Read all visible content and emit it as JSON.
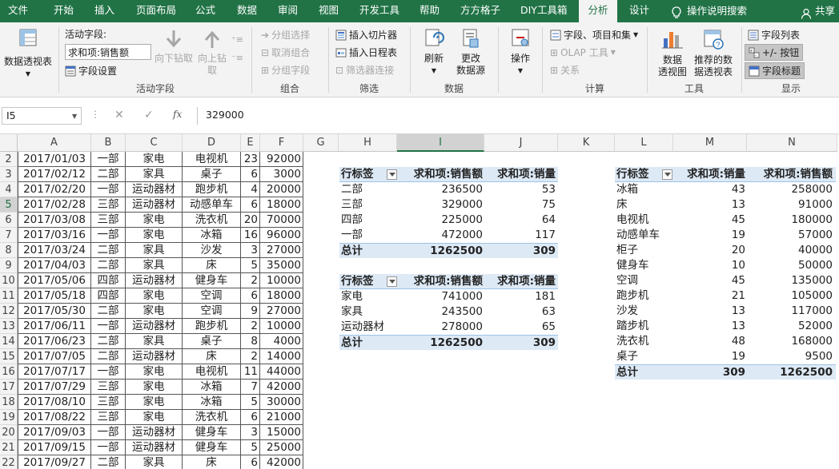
{
  "tabs": [
    "文件",
    "开始",
    "插入",
    "页面布局",
    "公式",
    "数据",
    "审阅",
    "视图",
    "开发工具",
    "帮助",
    "方方格子",
    "DIY工具箱",
    "分析",
    "设计"
  ],
  "tell_me": "操作说明搜索",
  "share": "共享",
  "ribbon": {
    "pivot_table": "数据透视表",
    "active_field_label": "活动字段:",
    "active_field_value": "求和项:销售额",
    "field_settings": "字段设置",
    "drill_down": "向下钻取",
    "drill_up_1": "向上钻",
    "drill_up_2": "取",
    "group_active_field": "活动字段",
    "group_selection": "分组选择",
    "ungroup": "取消组合",
    "group_field": "分组字段",
    "group_group": "组合",
    "insert_slicer": "插入切片器",
    "insert_timeline": "插入日程表",
    "filter_connections": "筛选器连接",
    "group_filter": "筛选",
    "refresh": "刷新",
    "change_source_1": "更改",
    "change_source_2": "数据源",
    "group_data": "数据",
    "actions": "操作",
    "fields_items_sets": "字段、项目和集",
    "olap_tools": "OLAP 工具",
    "relationships": "关系",
    "group_calc": "计算",
    "pivot_chart_1": "数据",
    "pivot_chart_2": "透视图",
    "recommended_1": "推荐的数",
    "recommended_2": "据透视表",
    "group_tools": "工具",
    "field_list": "字段列表",
    "plus_minus": "+/- 按钮",
    "field_headers": "字段标题",
    "group_show": "显示"
  },
  "formula_bar": {
    "name_box": "I5",
    "cancel": "✕",
    "enter": "✓",
    "fx": "fx",
    "content": "329000"
  },
  "columns": [
    "A",
    "B",
    "C",
    "D",
    "E",
    "F",
    "G",
    "H",
    "I",
    "J",
    "K",
    "L",
    "M",
    "N"
  ],
  "rows": [
    {
      "num": "2",
      "a": "2017/01/03",
      "b": "一部",
      "c": "家电",
      "d": "电视机",
      "e": "23",
      "f": "92000"
    },
    {
      "num": "3",
      "a": "2017/02/12",
      "b": "二部",
      "c": "家具",
      "d": "桌子",
      "e": "6",
      "f": "3000"
    },
    {
      "num": "4",
      "a": "2017/02/20",
      "b": "一部",
      "c": "运动器材",
      "d": "跑步机",
      "e": "4",
      "f": "20000"
    },
    {
      "num": "5",
      "a": "2017/02/28",
      "b": "三部",
      "c": "运动器材",
      "d": "动感单车",
      "e": "6",
      "f": "18000"
    },
    {
      "num": "6",
      "a": "2017/03/08",
      "b": "三部",
      "c": "家电",
      "d": "洗衣机",
      "e": "20",
      "f": "70000"
    },
    {
      "num": "7",
      "a": "2017/03/16",
      "b": "一部",
      "c": "家电",
      "d": "冰箱",
      "e": "16",
      "f": "96000"
    },
    {
      "num": "8",
      "a": "2017/03/24",
      "b": "二部",
      "c": "家具",
      "d": "沙发",
      "e": "3",
      "f": "27000"
    },
    {
      "num": "9",
      "a": "2017/04/03",
      "b": "二部",
      "c": "家具",
      "d": "床",
      "e": "5",
      "f": "35000"
    },
    {
      "num": "10",
      "a": "2017/05/06",
      "b": "四部",
      "c": "运动器材",
      "d": "健身车",
      "e": "2",
      "f": "10000"
    },
    {
      "num": "11",
      "a": "2017/05/18",
      "b": "四部",
      "c": "家电",
      "d": "空调",
      "e": "6",
      "f": "18000"
    },
    {
      "num": "12",
      "a": "2017/05/30",
      "b": "二部",
      "c": "家电",
      "d": "空调",
      "e": "9",
      "f": "27000"
    },
    {
      "num": "13",
      "a": "2017/06/11",
      "b": "一部",
      "c": "运动器材",
      "d": "跑步机",
      "e": "2",
      "f": "10000"
    },
    {
      "num": "14",
      "a": "2017/06/23",
      "b": "二部",
      "c": "家具",
      "d": "桌子",
      "e": "8",
      "f": "4000"
    },
    {
      "num": "15",
      "a": "2017/07/05",
      "b": "二部",
      "c": "运动器材",
      "d": "床",
      "e": "2",
      "f": "14000"
    },
    {
      "num": "16",
      "a": "2017/07/17",
      "b": "一部",
      "c": "家电",
      "d": "电视机",
      "e": "11",
      "f": "44000"
    },
    {
      "num": "17",
      "a": "2017/07/29",
      "b": "三部",
      "c": "家电",
      "d": "冰箱",
      "e": "7",
      "f": "42000"
    },
    {
      "num": "18",
      "a": "2017/08/10",
      "b": "三部",
      "c": "家电",
      "d": "冰箱",
      "e": "5",
      "f": "30000"
    },
    {
      "num": "19",
      "a": "2017/08/22",
      "b": "三部",
      "c": "家电",
      "d": "洗衣机",
      "e": "6",
      "f": "21000"
    },
    {
      "num": "20",
      "a": "2017/09/03",
      "b": "一部",
      "c": "运动器材",
      "d": "健身车",
      "e": "3",
      "f": "15000"
    },
    {
      "num": "21",
      "a": "2017/09/15",
      "b": "一部",
      "c": "运动器材",
      "d": "健身车",
      "e": "5",
      "f": "25000"
    },
    {
      "num": "22",
      "a": "2017/09/27",
      "b": "二部",
      "c": "家具",
      "d": "床",
      "e": "6",
      "f": "42000"
    }
  ],
  "pivot1": {
    "h_row": "行标签",
    "h_sales": "求和项:销售额",
    "h_qty": "求和项:销量",
    "items": [
      {
        "label": "二部",
        "sales": "236500",
        "qty": "53"
      },
      {
        "label": "三部",
        "sales": "329000",
        "qty": "75"
      },
      {
        "label": "四部",
        "sales": "225000",
        "qty": "64"
      },
      {
        "label": "一部",
        "sales": "472000",
        "qty": "117"
      }
    ],
    "total_label": "总计",
    "total_sales": "1262500",
    "total_qty": "309"
  },
  "pivot2": {
    "h_row": "行标签",
    "h_sales": "求和项:销售额",
    "h_qty": "求和项:销量",
    "items": [
      {
        "label": "家电",
        "sales": "741000",
        "qty": "181"
      },
      {
        "label": "家具",
        "sales": "243500",
        "qty": "63"
      },
      {
        "label": "运动器材",
        "sales": "278000",
        "qty": "65"
      }
    ],
    "total_label": "总计",
    "total_sales": "1262500",
    "total_qty": "309"
  },
  "pivot3": {
    "h_row": "行标签",
    "h_qty": "求和项:销量",
    "h_sales": "求和项:销售额",
    "items": [
      {
        "label": "冰箱",
        "qty": "43",
        "sales": "258000"
      },
      {
        "label": "床",
        "qty": "13",
        "sales": "91000"
      },
      {
        "label": "电视机",
        "qty": "45",
        "sales": "180000"
      },
      {
        "label": "动感单车",
        "qty": "19",
        "sales": "57000"
      },
      {
        "label": "柜子",
        "qty": "20",
        "sales": "40000"
      },
      {
        "label": "健身车",
        "qty": "10",
        "sales": "50000"
      },
      {
        "label": "空调",
        "qty": "45",
        "sales": "135000"
      },
      {
        "label": "跑步机",
        "qty": "21",
        "sales": "105000"
      },
      {
        "label": "沙发",
        "qty": "13",
        "sales": "117000"
      },
      {
        "label": "踏步机",
        "qty": "13",
        "sales": "52000"
      },
      {
        "label": "洗衣机",
        "qty": "48",
        "sales": "168000"
      },
      {
        "label": "桌子",
        "qty": "19",
        "sales": "9500"
      }
    ],
    "total_label": "总计",
    "total_qty": "309",
    "total_sales": "1262500"
  },
  "colors": {
    "excel_green": "#217346",
    "ribbon_bg": "#f3f3f3",
    "pivot_header": "#dde9f5"
  }
}
